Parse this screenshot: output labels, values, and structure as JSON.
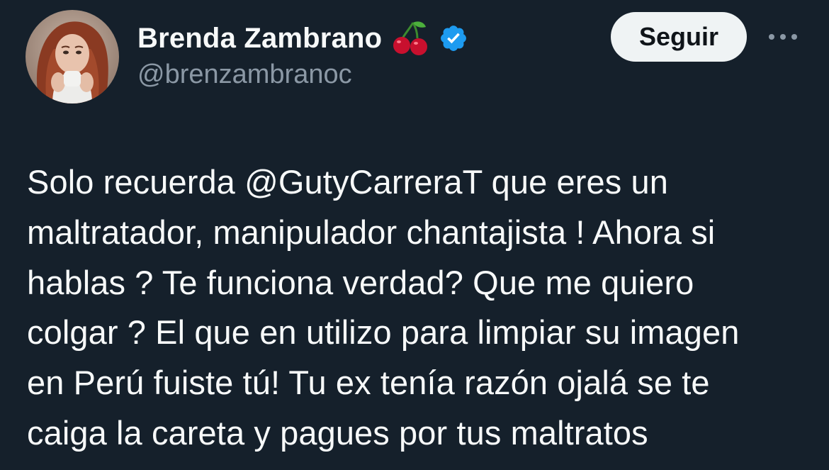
{
  "user": {
    "display_name": "Brenda Zambrano",
    "name_emoji": "cherries-emoji",
    "verified_icon": "verified-badge-icon",
    "handle": "@brenzambranoc",
    "avatar_icon": "avatar"
  },
  "actions": {
    "follow_label": "Seguir",
    "more_icon": "more-options-icon"
  },
  "tweet": {
    "text": "Solo recuerda @GutyCarreraT que eres un\nmaltratador, manipulador chantajista ! Ahora si\nhablas ? Te funciona verdad? Que me quiero\ncolgar ? El que en utilizo para limpiar su imagen\nen Perú fuiste tú! Tu ex tenía razón ojalá se te\ncaiga la careta y pagues por tus maltratos"
  },
  "colors": {
    "background": "#15202b",
    "text_primary": "#f7f9f9",
    "text_secondary": "#8b98a5",
    "verified": "#1d9bf0",
    "follow_button_bg": "#eff3f4"
  }
}
